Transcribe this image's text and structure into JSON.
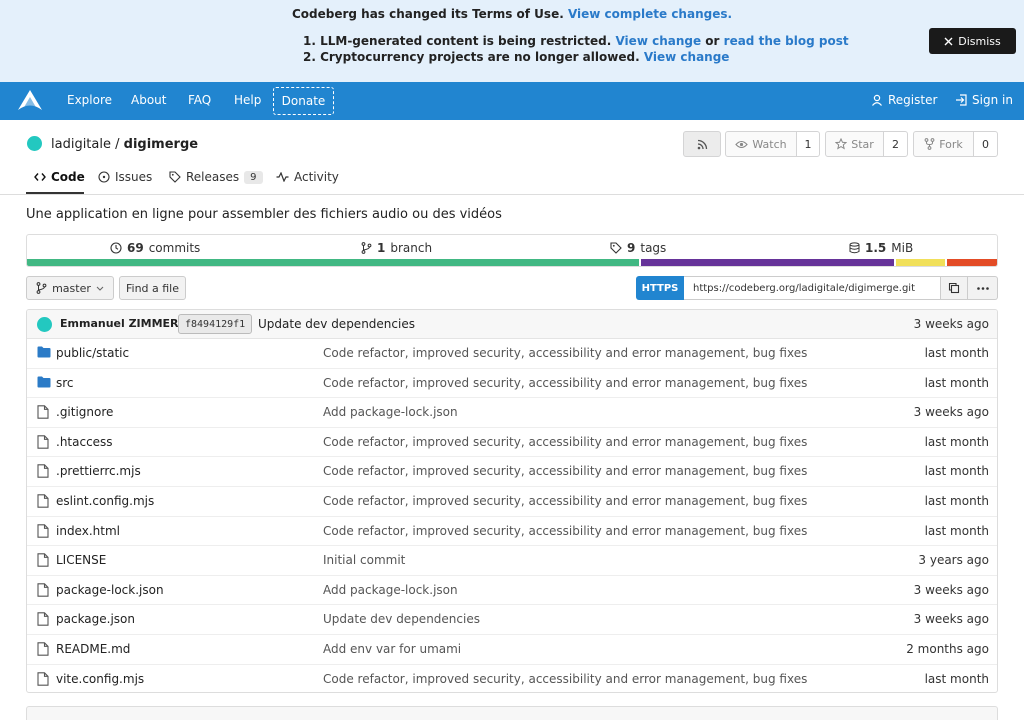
{
  "banner": {
    "line1_text": "Codeberg has changed its Terms of Use.",
    "line1_link": "View complete changes.",
    "line2_prefix": "1. LLM-generated content is being restricted.",
    "line2_link1": "View change",
    "line2_or": "or",
    "line2_link2": "read the blog post",
    "line3_prefix": "2. Cryptocurrency projects are no longer allowed.",
    "line3_link": "View change",
    "dismiss_label": "Dismiss"
  },
  "nav": {
    "items": [
      "Explore",
      "About",
      "FAQ",
      "Help"
    ],
    "donate": "Donate",
    "register": "Register",
    "signin": "Sign in"
  },
  "repo": {
    "owner": "ladigitale",
    "separator": "/",
    "name": "digimerge",
    "watch_label": "Watch",
    "watch_count": "1",
    "star_label": "Star",
    "star_count": "2",
    "fork_label": "Fork",
    "fork_count": "0",
    "description": "Une application en ligne pour assembler des fichiers audio ou des vidéos"
  },
  "tabs": {
    "code": "Code",
    "issues": "Issues",
    "releases": "Releases",
    "releases_count": "9",
    "activity": "Activity"
  },
  "stats": {
    "commits_num": "69",
    "commits_label": "commits",
    "branch_num": "1",
    "branch_label": "branch",
    "tags_num": "9",
    "tags_label": "tags",
    "size_num": "1.5",
    "size_label": "MiB"
  },
  "languages": [
    {
      "percent": 63,
      "color": "#41b883"
    },
    {
      "percent": 26,
      "color": "#663399"
    },
    {
      "percent": 5,
      "color": "#f1e05a"
    },
    {
      "percent": 3,
      "color": "#e34c26"
    }
  ],
  "toolbar": {
    "branch": "master",
    "find_file": "Find a file",
    "https": "HTTPS",
    "clone_url": "https://codeberg.org/ladigitale/digimerge.git"
  },
  "latest_commit": {
    "author": "Emmanuel ZIMMERT",
    "sha": "f8494129f1",
    "message": "Update dev dependencies",
    "time": "3 weeks ago"
  },
  "files": [
    {
      "name_prefix": "public/",
      "name": "static",
      "type": "folder",
      "message": "Code refactor, improved security, accessibility and error management, bug fixes",
      "time": "last month"
    },
    {
      "name_prefix": "",
      "name": "src",
      "type": "folder",
      "message": "Code refactor, improved security, accessibility and error management, bug fixes",
      "time": "last month"
    },
    {
      "name_prefix": "",
      "name": ".gitignore",
      "type": "file",
      "message": "Add package-lock.json",
      "time": "3 weeks ago"
    },
    {
      "name_prefix": "",
      "name": ".htaccess",
      "type": "file",
      "message": "Code refactor, improved security, accessibility and error management, bug fixes",
      "time": "last month"
    },
    {
      "name_prefix": "",
      "name": ".prettierrc.mjs",
      "type": "file",
      "message": "Code refactor, improved security, accessibility and error management, bug fixes",
      "time": "last month"
    },
    {
      "name_prefix": "",
      "name": "eslint.config.mjs",
      "type": "file",
      "message": "Code refactor, improved security, accessibility and error management, bug fixes",
      "time": "last month"
    },
    {
      "name_prefix": "",
      "name": "index.html",
      "type": "file",
      "message": "Code refactor, improved security, accessibility and error management, bug fixes",
      "time": "last month"
    },
    {
      "name_prefix": "",
      "name": "LICENSE",
      "type": "file",
      "message": "Initial commit",
      "time": "3 years ago"
    },
    {
      "name_prefix": "",
      "name": "package-lock.json",
      "type": "file",
      "message": "Add package-lock.json",
      "time": "3 weeks ago"
    },
    {
      "name_prefix": "",
      "name": "package.json",
      "type": "file",
      "message": "Update dev dependencies",
      "time": "3 weeks ago"
    },
    {
      "name_prefix": "",
      "name": "README.md",
      "type": "file",
      "message": "Add env var for umami",
      "time": "2 months ago"
    },
    {
      "name_prefix": "",
      "name": "vite.config.mjs",
      "type": "file",
      "message": "Code refactor, improved security, accessibility and error management, bug fixes",
      "time": "last month"
    }
  ]
}
